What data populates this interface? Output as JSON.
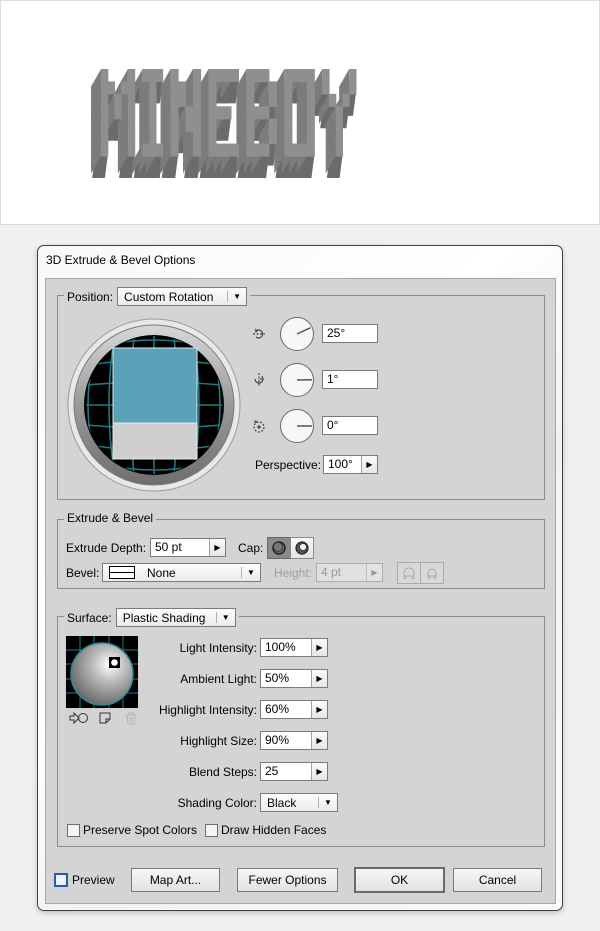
{
  "artwork": {
    "text": "MINEBOY",
    "face_color": "#8f8f8f",
    "side_color": "#6b6b6b"
  },
  "dialog": {
    "title": "3D Extrude & Bevel Options",
    "position": {
      "label": "Position:",
      "selected": "Custom Rotation",
      "x_axis": {
        "icon": "rotate-x-axis-icon",
        "value": "25°",
        "angle_deg": 25
      },
      "y_axis": {
        "icon": "rotate-y-axis-icon",
        "value": "1°",
        "angle_deg": 1
      },
      "z_axis": {
        "icon": "rotate-z-axis-icon",
        "value": "0°",
        "angle_deg": 0
      },
      "perspective_label": "Perspective:",
      "perspective_value": "100°",
      "cube_front_color": "#5ba1b8",
      "cube_bottom_color": "#cfcfcf"
    },
    "extrude_bevel": {
      "legend": "Extrude & Bevel",
      "depth_label": "Extrude Depth:",
      "depth_value": "50 pt",
      "cap_label": "Cap:",
      "cap_on_active": true,
      "bevel_label": "Bevel:",
      "bevel_selected": "None",
      "height_label": "Height:",
      "height_value": "4 pt",
      "height_disabled": true
    },
    "surface": {
      "label": "Surface:",
      "selected": "Plastic Shading",
      "fields": [
        {
          "label": "Light Intensity:",
          "value": "100%"
        },
        {
          "label": "Ambient Light:",
          "value": "50%"
        },
        {
          "label": "Highlight Intensity:",
          "value": "60%"
        },
        {
          "label": "Highlight Size:",
          "value": "90%"
        },
        {
          "label": "Blend Steps:",
          "value": "25"
        }
      ],
      "shading_color_label": "Shading Color:",
      "shading_color_value": "Black",
      "preserve_spot_colors": {
        "label": "Preserve Spot Colors",
        "checked": false
      },
      "draw_hidden_faces": {
        "label": "Draw Hidden Faces",
        "checked": false
      }
    },
    "footer": {
      "preview": {
        "label": "Preview",
        "checked": false
      },
      "map_art": "Map Art...",
      "fewer_options": "Fewer Options",
      "ok": "OK",
      "cancel": "Cancel"
    }
  }
}
